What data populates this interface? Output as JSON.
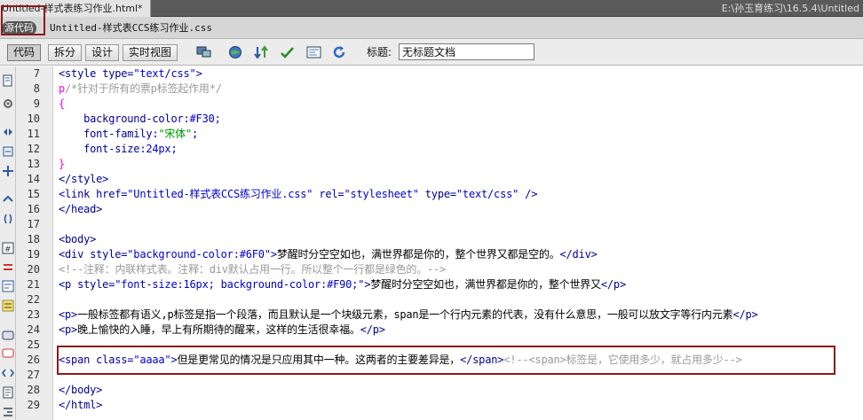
{
  "tabbar": {
    "doc_tab": "Untitled-样式表练习作业.html*",
    "path": "E:\\孙玉育练习\\16.5.4\\Untitled"
  },
  "filesbar": {
    "source_button": "源代码",
    "css_file": "Untitled-样式表CCS练习作业.css"
  },
  "toolbar": {
    "code_label": "代码",
    "split_label": "拆分",
    "design_label": "设计",
    "live_label": "实时视图",
    "title_label": "标题:",
    "title_value": "无标题文档"
  },
  "editor": {
    "line_numbers": [
      "7",
      "8",
      "9",
      "10",
      "11",
      "12",
      "13",
      "14",
      "15",
      "16",
      "17",
      "18",
      "19",
      "20",
      "21",
      "22",
      "23",
      "24",
      "25",
      "26",
      "27",
      "28",
      "29"
    ],
    "lines": {
      "l7": {
        "tag_open": "<style ",
        "attr": "type=",
        "val": "\"text/css\"",
        "tag_close": ">"
      },
      "l8": {
        "sel": "p",
        "comment": "/*针对于所有的票p标签起作用*/"
      },
      "l9": {
        "brace": "{"
      },
      "l10": {
        "prop": "background-color:",
        "val": "#F30;"
      },
      "l11": {
        "prop": "font-family:",
        "val": "\"宋体\"",
        "end": ";"
      },
      "l12": {
        "prop": "font-size:",
        "val": "24px;"
      },
      "l13": {
        "brace": "}"
      },
      "l14": {
        "tag": "</style>"
      },
      "l15": {
        "tag_open": "<link ",
        "a1": "href=",
        "v1": "\"Untitled-样式表CCS练习作业.css\"",
        "a2": " rel=",
        "v2": "\"stylesheet\"",
        "a3": " type=",
        "v3": "\"text/css\"",
        "tag_close": " />"
      },
      "l16": {
        "tag": "</head>"
      },
      "l18": {
        "tag": "<body>"
      },
      "l19": {
        "tag_open": "<div ",
        "attr": "style=",
        "val": "\"background-color:#6F0\"",
        "tag_close": ">",
        "text": "梦醒时分空空如也，满世界都是你的，整个世界又都是空的。",
        "end_tag": "</div>"
      },
      "l20": {
        "comment": "<!--注释：内联样式表。注释：div默认占用一行。所以整个一行都是绿色的。-->"
      },
      "l21": {
        "tag_open": "<p ",
        "attr": "style=",
        "val": "\"font-size:16px; background-color:#F90;\"",
        "tag_close": ">",
        "text": "梦醒时分空空如也，满世界都是你的，整个世界又",
        "end_tag": "</p>"
      },
      "l23": {
        "tag_open": "<p>",
        "text": "一般标签都有语义,p标签是指一个段落，而且默认是一个块级元素，span是一个行内元素的代表，没有什么意思，一般可以放文字等行内元素",
        "end_tag": "</p>"
      },
      "l24": {
        "tag_open": "<p>",
        "text": "晚上愉快的入睡，早上有所期待的醒来，这样的生活很幸福。",
        "end_tag": "</p>"
      },
      "l26": {
        "tag_open": "<span ",
        "attr": "class=",
        "val": "\"aaaa\"",
        "tag_close": ">",
        "text": "但是更常见的情况是只应用其中一种。这两者的主要差异是，",
        "end_tag": "</span>",
        "comment": "<!--<span>标签是，它使用多少，就占用多少-->"
      },
      "l28": {
        "tag": "</body>"
      },
      "l29": {
        "tag": "</html>"
      }
    }
  },
  "colors": {
    "highlight_box": "#8b1a1a",
    "tag": "#000099",
    "comment": "#999999",
    "selector": "#ff00ff"
  }
}
